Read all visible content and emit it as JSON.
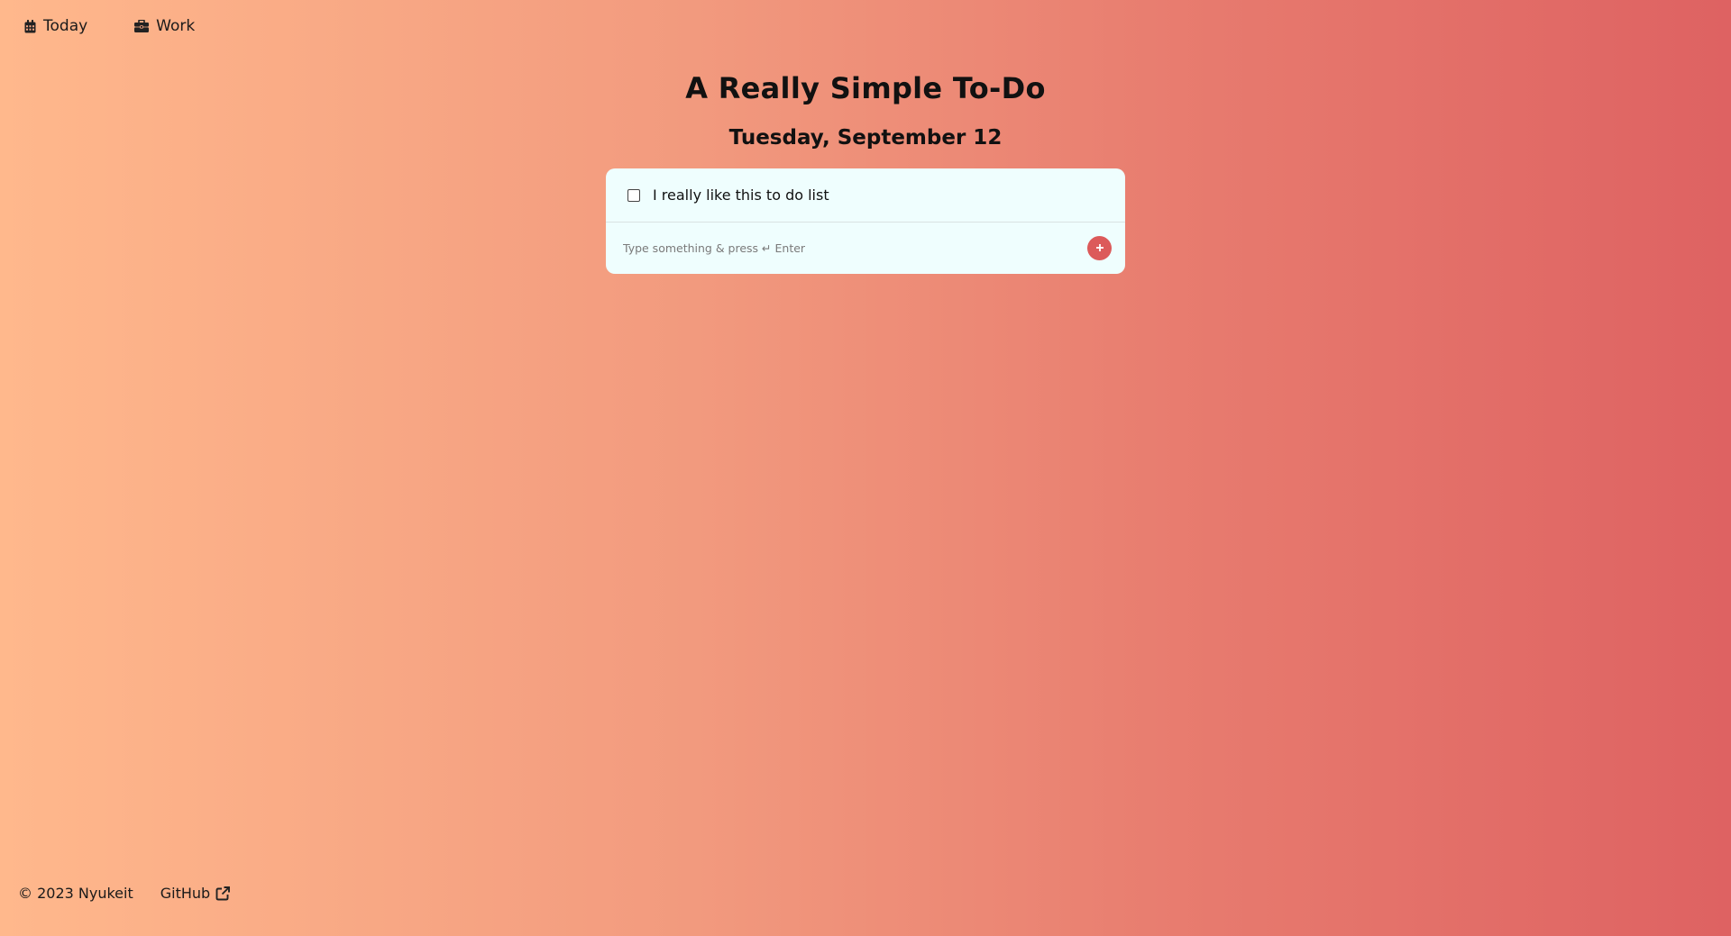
{
  "nav": {
    "items": [
      {
        "label": "Today",
        "icon": "calendar-icon"
      },
      {
        "label": "Work",
        "icon": "briefcase-icon"
      }
    ]
  },
  "header": {
    "title": "A Really Simple To-Do",
    "date": "Tuesday, September 12"
  },
  "todos": [
    {
      "text": "I really like this to do list",
      "done": false
    }
  ],
  "new_todo": {
    "placeholder": "Type something & press ↵ Enter",
    "value": "",
    "add_icon": "plus-icon"
  },
  "footer": {
    "copyright": "© 2023 Nyukeit",
    "github_label": "GitHub",
    "github_icon": "external-link-icon"
  },
  "colors": {
    "gradient_start": "#ffb88c",
    "gradient_end": "#de6262",
    "card_background": "#effefe",
    "accent": "#dc5a5a"
  }
}
